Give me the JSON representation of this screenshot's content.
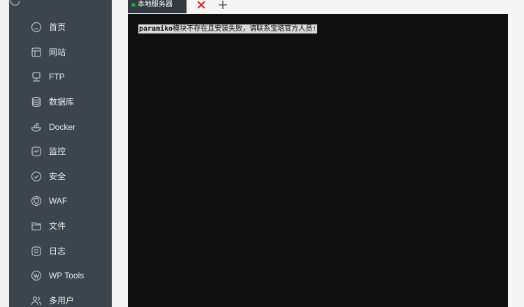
{
  "sidebar": {
    "items": [
      {
        "label": "首页",
        "icon": "home-icon"
      },
      {
        "label": "网站",
        "icon": "website-icon"
      },
      {
        "label": "FTP",
        "icon": "ftp-icon"
      },
      {
        "label": "数据库",
        "icon": "database-icon"
      },
      {
        "label": "Docker",
        "icon": "docker-icon"
      },
      {
        "label": "监控",
        "icon": "monitor-icon"
      },
      {
        "label": "安全",
        "icon": "security-icon"
      },
      {
        "label": "WAF",
        "icon": "waf-icon"
      },
      {
        "label": "文件",
        "icon": "folder-icon"
      },
      {
        "label": "日志",
        "icon": "log-icon"
      },
      {
        "label": "WP Tools",
        "icon": "wordpress-icon"
      },
      {
        "label": "多用户",
        "icon": "users-icon"
      }
    ]
  },
  "tabs": [
    {
      "label": "本地服务器",
      "status_color": "#20a53a"
    }
  ],
  "tab_close_color": "#e02020",
  "terminal": {
    "line_bold": "paramiko",
    "line_rest": "模块不存在且安装失败，请联系宝塔官方人员!"
  },
  "colors": {
    "sidebar_bg": "#3c444d",
    "terminal_bg": "#101010",
    "tab_bg": "#333a40"
  }
}
